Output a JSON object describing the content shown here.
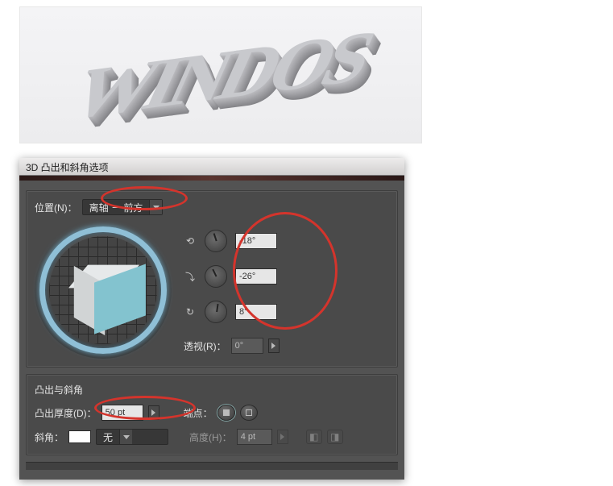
{
  "preview_text": "WINDOS",
  "dialog": {
    "title": "3D 凸出和斜角选项",
    "position_label": "位置(N)：",
    "position_value": "离轴 － 前方",
    "rotation": {
      "x": "-18°",
      "y": "-26°",
      "z": "8°"
    },
    "perspective_label": "透视(R)：",
    "perspective_value": "0°"
  },
  "extrude": {
    "group_title": "凸出与斜角",
    "depth_label": "凸出厚度(D)：",
    "depth_value": "50 pt",
    "cap_label": "端点：",
    "bevel_label": "斜角：",
    "bevel_value": "无",
    "height_label": "高度(H)：",
    "height_value": "4 pt"
  },
  "icons": {
    "axis_x": "⟲",
    "axis_y": "⤵",
    "axis_z": "↻"
  }
}
